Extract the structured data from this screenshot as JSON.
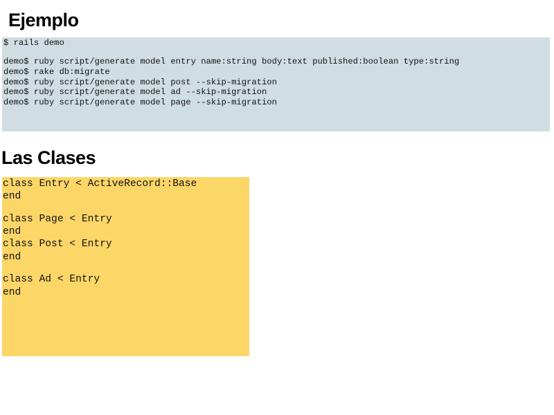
{
  "sections": {
    "example": {
      "title": "Ejemplo",
      "terminal_lines": [
        "$ rails demo",
        "",
        "demo$ ruby script/generate model entry name:string body:text published:boolean type:string",
        "demo$ rake db:migrate",
        "demo$ ruby script/generate model post --skip-migration",
        "demo$ ruby script/generate model ad --skip-migration",
        "demo$ ruby script/generate model page --skip-migration"
      ],
      "background_color": "#d0dde2"
    },
    "classes": {
      "title": "Las Clases",
      "code_lines": [
        "class Entry < ActiveRecord::Base",
        "end",
        "",
        "class Page < Entry",
        "end",
        "class Post < Entry",
        "end",
        "",
        "class Ad < Entry",
        "end"
      ],
      "background_color": "#fdd668"
    }
  }
}
